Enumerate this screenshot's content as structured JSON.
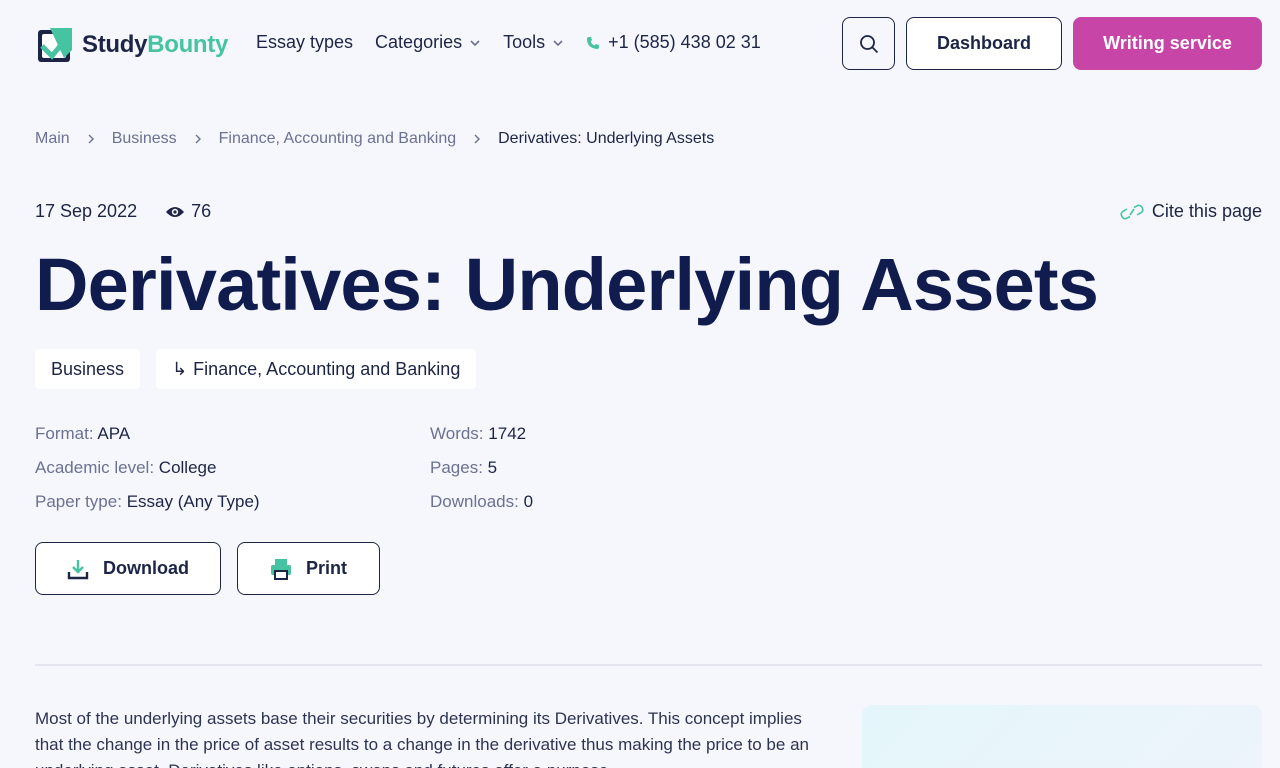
{
  "header": {
    "logo": {
      "study": "Study",
      "bounty": "Bounty"
    },
    "nav": [
      {
        "label": "Essay types",
        "has_dropdown": false
      },
      {
        "label": "Categories",
        "has_dropdown": true
      },
      {
        "label": "Tools",
        "has_dropdown": true
      }
    ],
    "phone": "+1 (585) 438 02 31",
    "search_icon": "search-icon",
    "dashboard_label": "Dashboard",
    "writing_label": "Writing service"
  },
  "breadcrumb": [
    "Main",
    "Business",
    "Finance, Accounting and Banking",
    "Derivatives: Underlying Assets"
  ],
  "meta": {
    "date": "17 Sep 2022",
    "views": "76",
    "cite_label": "Cite this page"
  },
  "title": "Derivatives: Underlying Assets",
  "tags": [
    "Business",
    "Finance, Accounting and Banking"
  ],
  "details": {
    "format": {
      "key": "Format:",
      "value": "APA"
    },
    "level": {
      "key": "Academic level:",
      "value": "College"
    },
    "paper_type": {
      "key": "Paper type:",
      "value": "Essay (Any Type)"
    },
    "words": {
      "key": "Words:",
      "value": "1742"
    },
    "pages": {
      "key": "Pages:",
      "value": "5"
    },
    "downloads": {
      "key": "Downloads:",
      "value": "0"
    }
  },
  "actions": {
    "download_label": "Download",
    "print_label": "Print"
  },
  "body": "Most of the underlying assets base their securities by determining its Derivatives. This concept implies that the change in the price of asset results to a change in the derivative thus making the price to be an underlying asset. Derivatives like options, swaps and futures offer a purpose",
  "colors": {
    "accent_pink": "#c845a8",
    "brand_green": "#46c4a2",
    "navy": "#111c4e"
  }
}
